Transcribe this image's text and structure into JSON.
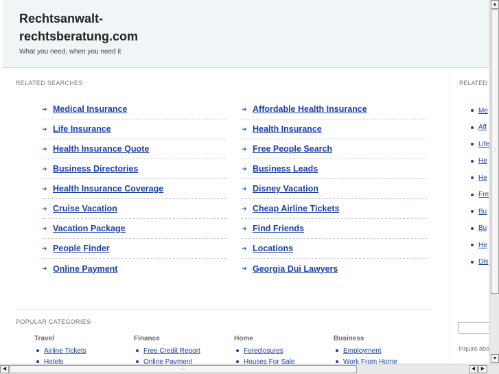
{
  "header": {
    "title": "Rechtsanwalt-rechtsberatung.com",
    "tagline": "What you need, when you need it"
  },
  "related_searches": {
    "heading": "RELATED SEARCHES",
    "col_a": [
      "Medical Insurance",
      "Life Insurance",
      "Health Insurance Quote",
      "Business Directories",
      "Health Insurance Coverage",
      "Cruise Vacation",
      "Vacation Package",
      "People Finder",
      "Online Payment"
    ],
    "col_b": [
      "Affordable Health Insurance",
      "Health Insurance",
      "Free People Search",
      "Business Leads",
      "Disney Vacation",
      "Cheap Airline Tickets",
      "Find Friends",
      "Locations",
      "Georgia Dui Lawyers"
    ]
  },
  "popular_categories": {
    "heading": "POPULAR CATEGORIES",
    "categories": [
      {
        "title": "Travel",
        "items": [
          "Airline Tickets",
          "Hotels"
        ]
      },
      {
        "title": "Finance",
        "items": [
          "Free Credit Report",
          "Online Payment"
        ]
      },
      {
        "title": "Home",
        "items": [
          "Foreclosures",
          "Houses For Sale"
        ]
      },
      {
        "title": "Business",
        "items": [
          "Employment",
          "Work From Home"
        ]
      }
    ]
  },
  "right_panel": {
    "heading": "RELATED",
    "items": [
      "Me",
      "Aff",
      "Life",
      "He",
      "He",
      "Fre",
      "Bu",
      "Bu",
      "He",
      "Dis"
    ],
    "inquire": "Inquire abo"
  },
  "icons": {
    "arrow": "arrow-right-icon",
    "bullet": "bullet-icon"
  },
  "colors": {
    "link": "#1a3ea8",
    "header_bg": "#f0f5f7"
  }
}
